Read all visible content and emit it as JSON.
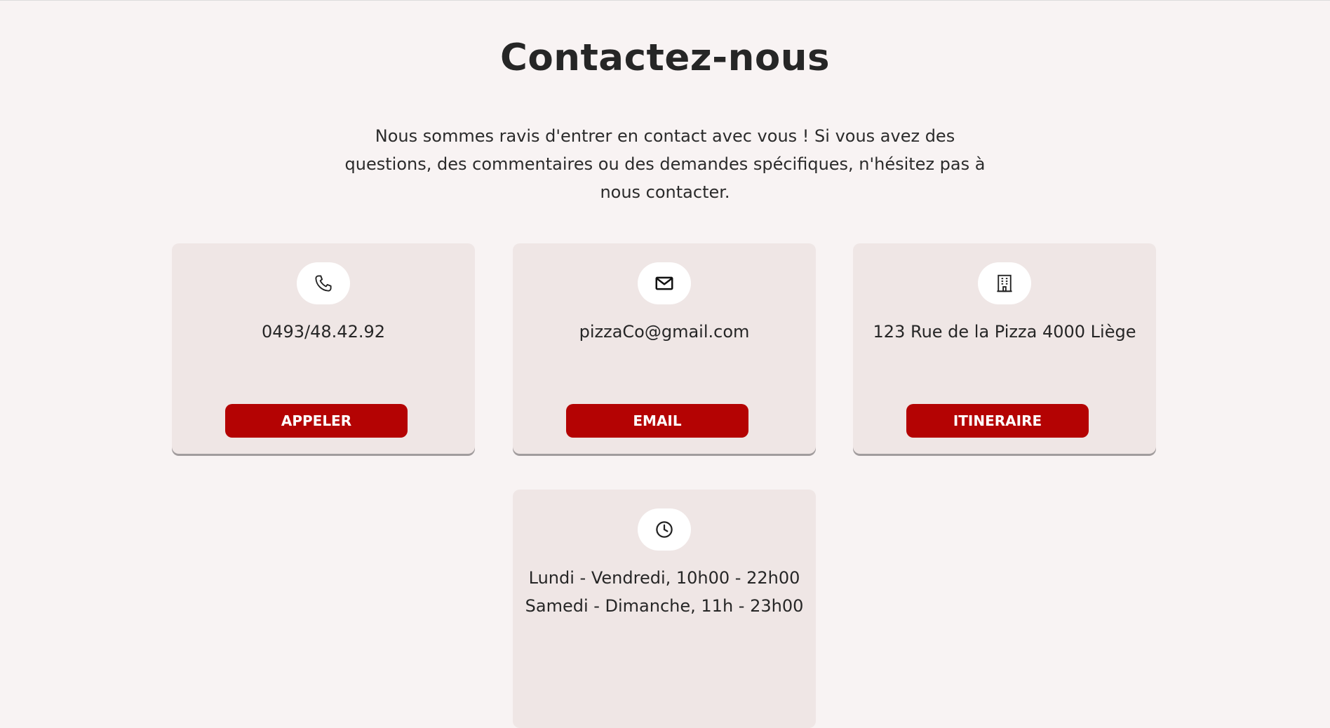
{
  "header": {
    "title": "Contactez-nous",
    "intro": "Nous sommes ravis d'entrer en contact avec vous ! Si vous avez des questions, des commentaires ou des demandes spécifiques, n'hésitez pas à nous contacter."
  },
  "cards": {
    "phone": {
      "icon": "phone-icon",
      "text": "0493/48.42.92",
      "button": "APPELER"
    },
    "email": {
      "icon": "envelope-icon",
      "text": "pizzaCo@gmail.com",
      "button": "EMAIL"
    },
    "address": {
      "icon": "building-icon",
      "text": "123 Rue de la Pizza 4000 Liège",
      "button": "ITINERAIRE"
    },
    "hours": {
      "icon": "clock-icon",
      "lines": [
        "Lundi - Vendredi, 10h00 - 22h00",
        "Samedi - Dimanche, 11h - 23h00"
      ]
    }
  },
  "colors": {
    "background": "#f8f3f3",
    "card": "#efe6e5",
    "accent": "#b40303"
  }
}
